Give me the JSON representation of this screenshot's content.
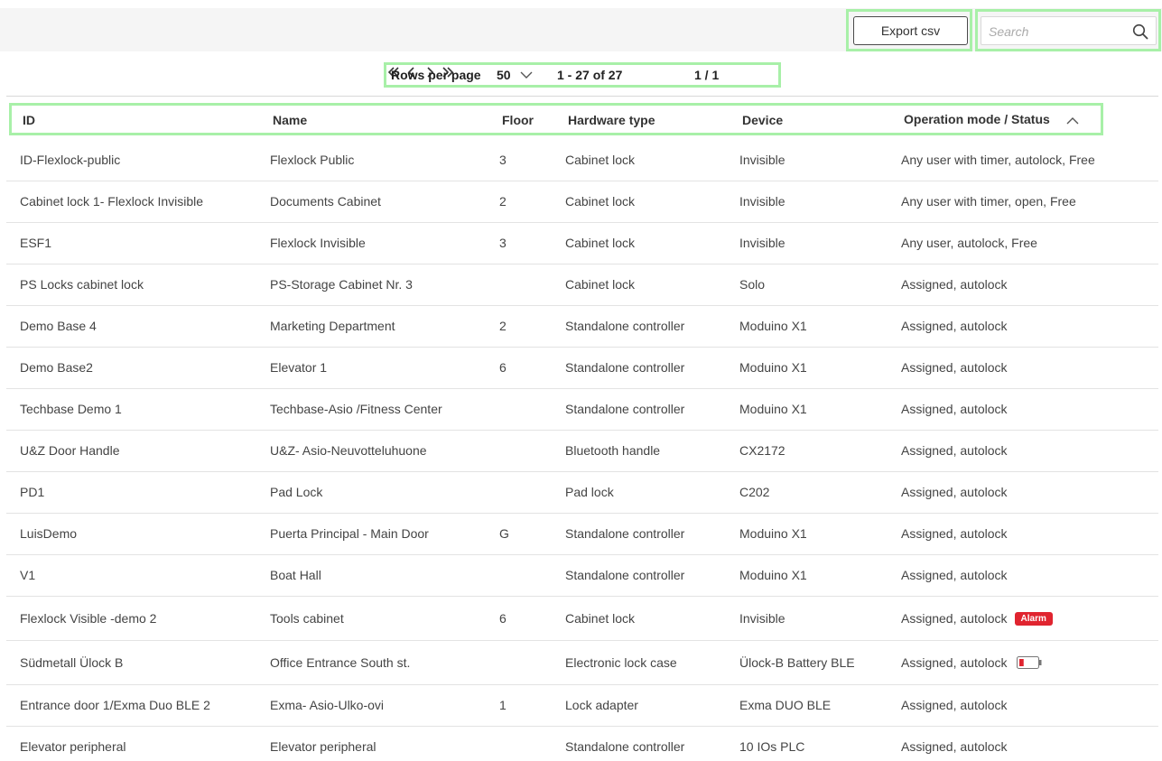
{
  "toolbar": {
    "export_label": "Export csv",
    "search_placeholder": "Search",
    "search_value": ""
  },
  "pagination": {
    "rows_per_page_label": "Rows per page",
    "rows_per_page_value": "50",
    "range_text": "1 - 27 of 27",
    "page_info": "1 / 1"
  },
  "table": {
    "columns": {
      "id": "ID",
      "name": "Name",
      "floor": "Floor",
      "hardware_type": "Hardware type",
      "device": "Device",
      "status": "Operation mode / Status"
    },
    "rows": [
      {
        "id": "ID-Flexlock-public",
        "name": "Flexlock Public",
        "floor": "3",
        "hardware_type": "Cabinet lock",
        "device": "Invisible",
        "status": "Any user with timer, autolock, Free"
      },
      {
        "id": "Cabinet lock 1- Flexlock Invisible",
        "name": "Documents Cabinet",
        "floor": "2",
        "hardware_type": "Cabinet lock",
        "device": "Invisible",
        "status": "Any user with timer, open, Free"
      },
      {
        "id": "ESF1",
        "name": "Flexlock Invisible",
        "floor": "3",
        "hardware_type": "Cabinet lock",
        "device": "Invisible",
        "status": "Any user, autolock, Free"
      },
      {
        "id": "PS Locks cabinet lock",
        "name": "PS-Storage Cabinet Nr. 3",
        "floor": "",
        "hardware_type": "Cabinet lock",
        "device": "Solo",
        "status": "Assigned, autolock"
      },
      {
        "id": "Demo Base 4",
        "name": "Marketing Department",
        "floor": "2",
        "hardware_type": "Standalone controller",
        "device": "Moduino X1",
        "status": "Assigned, autolock"
      },
      {
        "id": "Demo Base2",
        "name": "Elevator 1",
        "floor": "6",
        "hardware_type": "Standalone controller",
        "device": "Moduino X1",
        "status": "Assigned, autolock"
      },
      {
        "id": "Techbase Demo 1",
        "name": "Techbase-Asio /Fitness Center",
        "floor": "",
        "hardware_type": "Standalone controller",
        "device": "Moduino X1",
        "status": "Assigned, autolock"
      },
      {
        "id": "U&Z Door Handle",
        "name": "U&Z- Asio-Neuvotteluhuone",
        "floor": "",
        "hardware_type": "Bluetooth handle",
        "device": "CX2172",
        "status": "Assigned, autolock"
      },
      {
        "id": "PD1",
        "name": "Pad Lock",
        "floor": "",
        "hardware_type": "Pad lock",
        "device": "C202",
        "status": "Assigned, autolock"
      },
      {
        "id": "LuisDemo",
        "name": "Puerta Principal - Main Door",
        "floor": "G",
        "hardware_type": "Standalone controller",
        "device": "Moduino X1",
        "status": "Assigned, autolock"
      },
      {
        "id": "V1",
        "name": "Boat Hall",
        "floor": "",
        "hardware_type": "Standalone controller",
        "device": "Moduino X1",
        "status": "Assigned, autolock"
      },
      {
        "id": "Flexlock Visible -demo 2",
        "name": "Tools cabinet",
        "floor": "6",
        "hardware_type": "Cabinet lock",
        "device": "Invisible",
        "status": "Assigned, autolock",
        "badge": "Alarm"
      },
      {
        "id": "Südmetall Ülock B",
        "name": "Office Entrance South st.",
        "floor": "",
        "hardware_type": "Electronic lock case",
        "device": "Ülock-B Battery BLE",
        "status": "Assigned, autolock",
        "battery_level": 0.25
      },
      {
        "id": "Entrance door 1/Exma Duo BLE 2",
        "name": "Exma- Asio-Ulko-ovi",
        "floor": "1",
        "hardware_type": "Lock adapter",
        "device": "Exma DUO BLE",
        "status": "Assigned, autolock"
      },
      {
        "id": "Elevator peripheral",
        "name": "Elevator peripheral",
        "floor": "",
        "hardware_type": "Standalone controller",
        "device": "10 IOs PLC",
        "status": "Assigned, autolock"
      }
    ]
  },
  "colors": {
    "highlight": "#a8f0a8",
    "alarm": "#e0242f",
    "battery_low": "#e0242f"
  },
  "icons": {
    "search": "search-icon",
    "rows_dropdown": "chevron-down-icon",
    "first_page": "double-chevron-left-icon",
    "prev_page": "chevron-left-icon",
    "next_page": "chevron-right-icon",
    "last_page": "double-chevron-right-icon",
    "sort": "chevron-up-icon",
    "battery": "battery-low-icon"
  }
}
